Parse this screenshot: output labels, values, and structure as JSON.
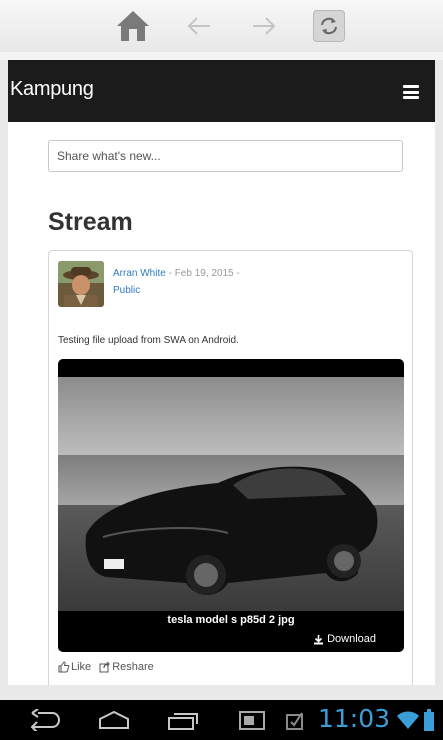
{
  "browser": {
    "buttons": [
      "home",
      "back",
      "forward",
      "refresh"
    ]
  },
  "header": {
    "brand": "Kampung"
  },
  "share": {
    "placeholder": "Share what's new..."
  },
  "stream": {
    "title": "Stream"
  },
  "post": {
    "author": "Arran White",
    "sep1": " - ",
    "date": "Feb 19, 2015",
    "sep2": " -",
    "visibility": "Public",
    "text": "Testing file upload from SWA on Android.",
    "attachment_caption": "tesla model s p85d 2 jpg",
    "download_label": "Download",
    "like_label": "Like",
    "reshare_label": "Reshare"
  },
  "status": {
    "time": "11:03"
  },
  "colors": {
    "link": "#2f7bbf",
    "clock": "#3a9fd8",
    "header_bg": "#1b1b1b"
  }
}
